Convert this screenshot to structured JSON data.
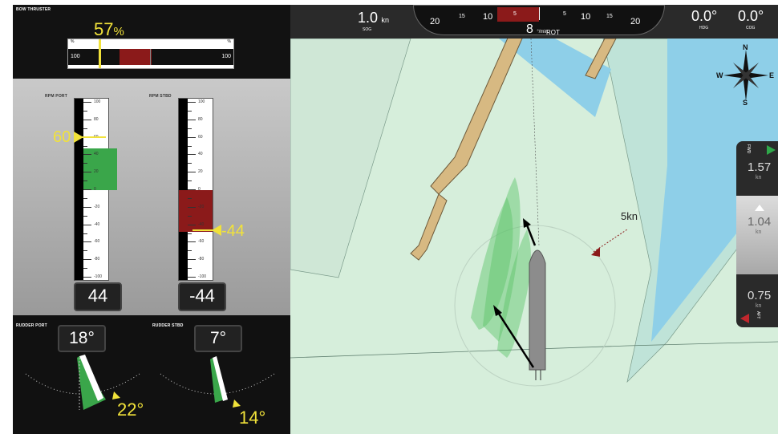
{
  "bow_thruster": {
    "title": "BOW THRUSTER",
    "value": "57",
    "unit": "%",
    "scale_left_pct": "%",
    "scale_right_pct": "%",
    "scale_left": "100",
    "scale_right": "100"
  },
  "rpm": {
    "port_label": "RPM PORT",
    "stbd_label": "RPM STBD",
    "port_setpoint": "60",
    "stbd_setpoint": "-44",
    "port_readout": "44",
    "stbd_readout": "-44",
    "scale": [
      "100",
      "80",
      "60",
      "40",
      "20",
      "0",
      "-20",
      "-40",
      "-60",
      "-80",
      "-100"
    ]
  },
  "rudder": {
    "port_label": "RUDDER PORT",
    "stbd_label": "RUDDER STBD",
    "port_value": "18°",
    "stbd_value": "7°",
    "port_setpoint": "22°",
    "stbd_setpoint": "14°"
  },
  "topbar": {
    "sog_value": "1.0",
    "sog_unit": "kn",
    "sog_label": "SOG",
    "rot_value": "8",
    "rot_unit": "°/min",
    "rot_label": "ROT",
    "rot_ticks": [
      "20",
      "15",
      "10",
      "5",
      "5",
      "10",
      "15",
      "20"
    ],
    "hdg_value": "0.0°",
    "hdg_label": "HDG",
    "cog_value": "0.0°",
    "cog_label": "COG"
  },
  "compass": {
    "n": "N",
    "s": "S",
    "e": "E",
    "w": "W"
  },
  "map": {
    "current_label": "5kn"
  },
  "speed_panel": {
    "fwd_label": "FWD",
    "fwd_value": "1.57",
    "fwd_unit": "kn",
    "mid_value": "1.04",
    "mid_unit": "kn",
    "aft_value": "0.75",
    "aft_unit": "kn",
    "aft_label": "AFT"
  },
  "colors": {
    "accent_yellow": "#f1e23a",
    "fwd_green": "#2fa84a",
    "aft_red": "#c0272d",
    "rpm_green": "#3aa64a",
    "rpm_red": "#8b1a1a"
  }
}
